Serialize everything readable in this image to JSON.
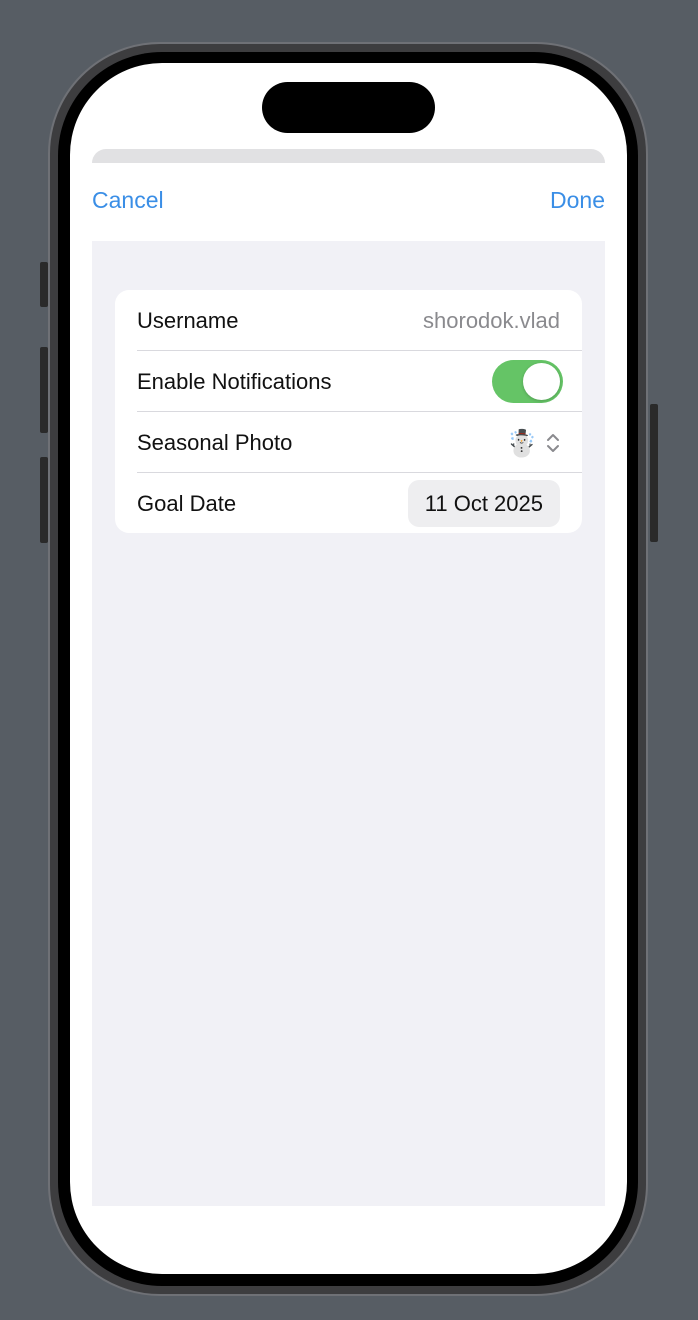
{
  "nav": {
    "cancel_label": "Cancel",
    "done_label": "Done"
  },
  "form": {
    "username": {
      "label": "Username",
      "value": "shorodok.vlad"
    },
    "notifications": {
      "label": "Enable Notifications",
      "enabled": true
    },
    "seasonal_photo": {
      "label": "Seasonal Photo",
      "selected_value": "☃️",
      "icon": "chevron-up-down-icon"
    },
    "goal_date": {
      "label": "Goal Date",
      "value": "11 Oct 2025"
    }
  },
  "colors": {
    "accent": "#3a8ee6",
    "toggle_on": "#65c466",
    "form_background": "#f1f1f6",
    "page_background": "#575d64"
  }
}
